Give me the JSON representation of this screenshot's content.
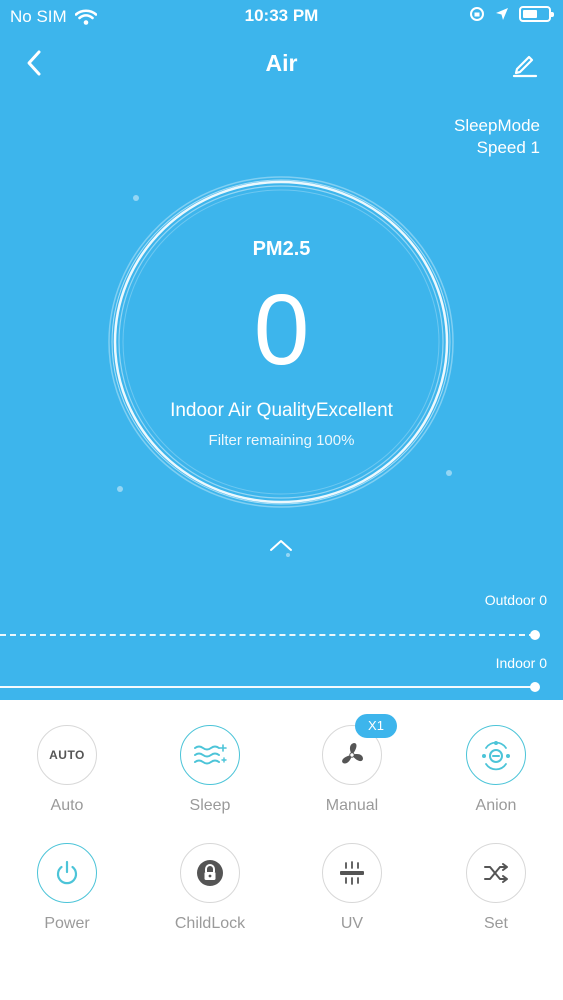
{
  "status_bar": {
    "carrier": "No SIM",
    "time": "10:33 PM"
  },
  "header": {
    "title": "Air"
  },
  "mode_info": {
    "mode": "SleepMode",
    "speed": "Speed 1"
  },
  "gauge": {
    "label": "PM2.5",
    "value": "0",
    "quality": "Indoor Air QualityExcellent",
    "filter": "Filter remaining 100%"
  },
  "trend": {
    "outdoor": "Outdoor 0",
    "indoor": "Indoor 0"
  },
  "controls": {
    "auto": {
      "label": "Auto",
      "icon_text": "AUTO"
    },
    "sleep": {
      "label": "Sleep"
    },
    "manual": {
      "label": "Manual",
      "badge": "X1"
    },
    "anion": {
      "label": "Anion"
    },
    "power": {
      "label": "Power"
    },
    "childlock": {
      "label": "ChildLock"
    },
    "uv": {
      "label": "UV"
    },
    "set": {
      "label": "Set"
    }
  },
  "colors": {
    "primary": "#3db5ec",
    "accent": "#4cc4d8",
    "icon_dark": "#555555",
    "label_gray": "#9a9a9a"
  }
}
